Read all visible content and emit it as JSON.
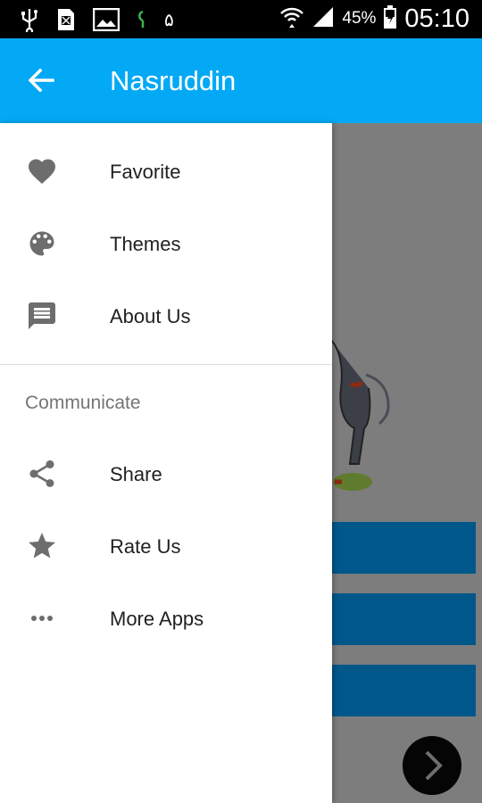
{
  "status_bar": {
    "battery_percent": "45%",
    "time": "05:10",
    "left_icons": [
      "usb-icon",
      "sim-icon",
      "gallery-icon",
      "notification-icon",
      "number-icon"
    ],
    "left_number": "۵"
  },
  "toolbar": {
    "title": "Nasruddin",
    "back_icon": "arrow-back-icon",
    "color": "#03a9f4"
  },
  "drawer": {
    "items": [
      {
        "label": "Favorite",
        "icon": "heart-icon"
      },
      {
        "label": "Themes",
        "icon": "palette-icon"
      },
      {
        "label": "About Us",
        "icon": "message-icon"
      }
    ],
    "section_header": "Communicate",
    "communicate_items": [
      {
        "label": "Share",
        "icon": "share-icon"
      },
      {
        "label": "Rate Us",
        "icon": "star-icon"
      },
      {
        "label": "More Apps",
        "icon": "more-horiz-icon"
      }
    ]
  },
  "background": {
    "button_color": "#00578a",
    "fab_icon": "chevron-right-icon"
  }
}
